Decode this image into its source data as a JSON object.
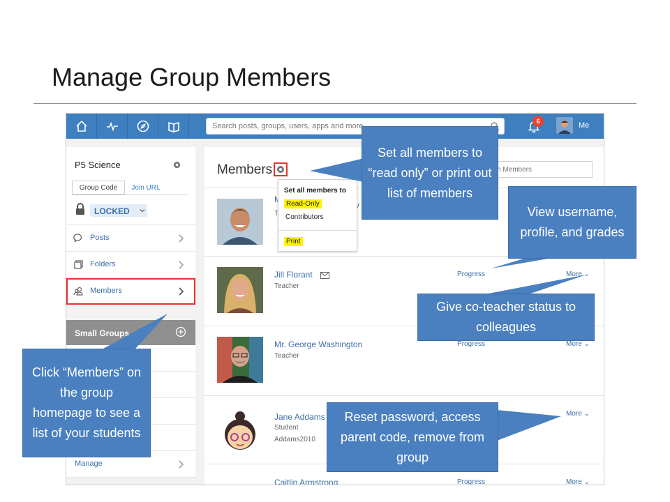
{
  "slide": {
    "title": "Manage Group Members"
  },
  "topnav": {
    "icons": [
      "home-icon",
      "activity-icon",
      "discover-icon",
      "backpack-icon"
    ],
    "search_placeholder": "Search posts, groups, users, apps and more...",
    "notification_count": "6",
    "me_label": "Me"
  },
  "sidebar": {
    "group_name": "P5 Science",
    "tab_group_code": "Group Code",
    "tab_join_url": "Join URL",
    "locked_label": "LOCKED",
    "items": [
      {
        "label": "Posts",
        "icon": "speech-bubble-icon"
      },
      {
        "label": "Folders",
        "icon": "folders-icon"
      },
      {
        "label": "Members",
        "icon": "members-icon"
      }
    ],
    "small_groups_label": "Small Groups",
    "manage_label": "Manage"
  },
  "main": {
    "title": "Members",
    "search_placeholder": "h Members",
    "dropdown": {
      "header": "Set all members to",
      "read_only": "Read-Only",
      "contributors": "Contributors",
      "print": "Print"
    },
    "members": [
      {
        "name": "M",
        "role": "T",
        "tail": "v"
      },
      {
        "name": "Jill Florant",
        "role": "Teacher",
        "progress": "Progress",
        "more": "More ⌄"
      },
      {
        "name": "Mr. George Washington",
        "role": "Teacher",
        "progress": "Progress",
        "more": "More ⌄"
      },
      {
        "name": "Jane Addams",
        "role": "Student",
        "username": "Addams2010",
        "more": "More ⌄"
      },
      {
        "name": "Caitlin Armstrong",
        "progress": "Progress",
        "more": "More ⌄"
      }
    ]
  },
  "callouts": {
    "read_only": "Set all members to “read only” or print out list of members",
    "view_username": "View username, profile, and grades",
    "co_teacher": "Give co-teacher status to colleagues",
    "click_members": "Click “Members” on the group homepage to see a list of your students",
    "reset_password": "Reset password, access parent code, remove from group"
  },
  "colors": {
    "nav_blue": "#3d7fbf",
    "callout_blue": "#4a7fc0",
    "highlight_red": "#e3342f",
    "highlight_yellow": "#fff200",
    "badge_red": "#e8432f"
  }
}
